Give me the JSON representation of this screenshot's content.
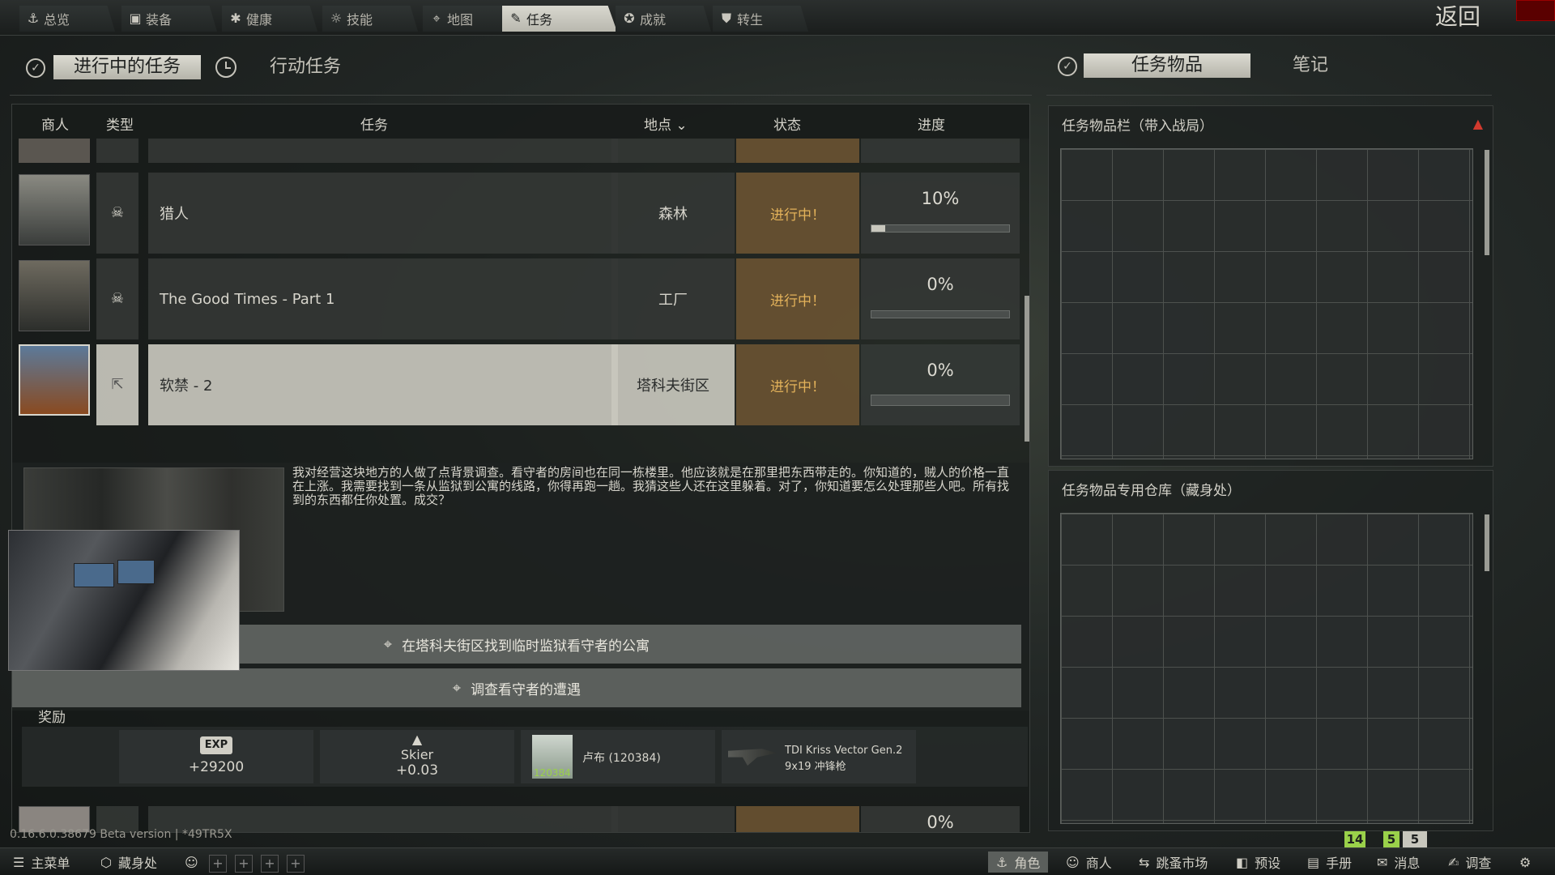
{
  "nav": {
    "tabs": [
      {
        "label": "总览",
        "icon": "overview-icon",
        "glyph": "⚓"
      },
      {
        "label": "装备",
        "icon": "gear-icon",
        "glyph": "▣"
      },
      {
        "label": "健康",
        "icon": "health-icon",
        "glyph": "✱"
      },
      {
        "label": "技能",
        "icon": "skills-icon",
        "glyph": "☼"
      },
      {
        "label": "地图",
        "icon": "map-pin-icon",
        "glyph": "⌖"
      },
      {
        "label": "任务",
        "icon": "tasks-icon",
        "glyph": "✎"
      },
      {
        "label": "成就",
        "icon": "achievements-icon",
        "glyph": "✪"
      },
      {
        "label": "转生",
        "icon": "prestige-icon",
        "glyph": "⛊"
      }
    ],
    "active_tab": "任务",
    "back_label": "返回"
  },
  "left_header": {
    "active_label": "进行中的任务",
    "inactive_label": "行动任务"
  },
  "table": {
    "columns": {
      "trader": "商人",
      "type": "类型",
      "task": "任务",
      "location": "地点",
      "status": "状态",
      "progress": "进度"
    },
    "location_sort_glyph": "⌄",
    "rows": [
      {
        "name": "猎人",
        "type_glyph": "☠",
        "type_icon": "elimination-icon",
        "location": "森林",
        "status": "进行中！",
        "progress_text": "10%",
        "progress": 0.1
      },
      {
        "name": "The Good Times - Part 1",
        "type_glyph": "☠",
        "type_icon": "elimination-icon",
        "location": "工厂",
        "status": "进行中！",
        "progress_text": "0%",
        "progress": 0.0
      },
      {
        "name": "软禁 - 2",
        "type_glyph": "⇱",
        "type_icon": "discover-icon",
        "location": "塔科夫街区",
        "status": "进行中！",
        "progress_text": "0%",
        "progress": 0.0
      }
    ],
    "next_row_progress": "0%"
  },
  "description": "我对经营这块地方的人做了点背景调查。看守者的房间也在同一栋楼里。他应该就是在那里把东西带走的。你知道的，贼人的价格一直在上涨。我需要找到一条从监狱到公寓的线路，你得再跑一趟。我猜这些人还在这里躲着。对了，你知道要怎么处理那些人吧。所有找到的东西都任你处置。成交？",
  "objectives": [
    "在塔科夫街区找到临时监狱看守者的公寓",
    "调查看守者的遭遇"
  ],
  "rewards": {
    "title": "奖励",
    "exp_badge": "EXP",
    "exp_value": "+29200",
    "standing_trader": "Skier",
    "standing_value": "+0.03",
    "item1_name": "卢布 (120384)",
    "item1_count": "120384",
    "item2_name": "TDI Kriss Vector Gen.2",
    "item2_sub": "9x19 冲锋枪"
  },
  "right_header": {
    "active_label": "任务物品",
    "inactive_label": "笔记"
  },
  "right_sections": {
    "stash_title": "任务物品栏（带入战局）",
    "storage_title": "任务物品专用仓库（藏身处）"
  },
  "bottom_bar": {
    "left": [
      {
        "label": "主菜单",
        "icon": "menu-icon",
        "glyph": "☰"
      },
      {
        "label": "藏身处",
        "icon": "hideout-icon",
        "glyph": "⬡"
      }
    ],
    "right": [
      {
        "label": "角色",
        "icon": "character-icon",
        "glyph": "⚓"
      },
      {
        "label": "商人",
        "icon": "traders-icon",
        "glyph": "☺"
      },
      {
        "label": "跳蚤市场",
        "icon": "flea-market-icon",
        "glyph": "⇆"
      },
      {
        "label": "预设",
        "icon": "presets-icon",
        "glyph": "◧"
      },
      {
        "label": "手册",
        "icon": "handbook-icon",
        "glyph": "▤"
      },
      {
        "label": "消息",
        "icon": "messages-icon",
        "glyph": "✉"
      },
      {
        "label": "调查",
        "icon": "survey-icon",
        "glyph": "✍"
      }
    ],
    "counters": [
      "14",
      "5",
      "5"
    ]
  },
  "version_text": "0.16.6.0.38679 Beta version | *49TR5X",
  "colors": {
    "accent": "#c9c8be",
    "status_bg": "#6a5332",
    "status_text": "#e3b25a",
    "counter_green": "#9ad14a"
  }
}
